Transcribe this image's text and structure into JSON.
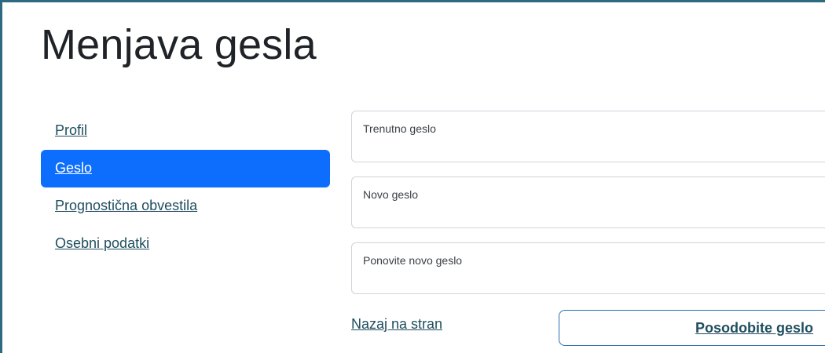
{
  "page": {
    "title": "Menjava gesla"
  },
  "sidebar": {
    "items": [
      {
        "label": "Profil",
        "active": false
      },
      {
        "label": "Geslo",
        "active": true
      },
      {
        "label": "Prognostična obvestila",
        "active": false
      },
      {
        "label": "Osebni podatki",
        "active": false
      }
    ]
  },
  "form": {
    "current_password": {
      "label": "Trenutno geslo",
      "value": ""
    },
    "new_password": {
      "label": "Novo geslo",
      "value": ""
    },
    "repeat_password": {
      "label": "Ponovite novo geslo",
      "value": ""
    },
    "back_link": "Nazaj na stran",
    "submit_label": "Posodobite geslo"
  },
  "colors": {
    "accent": "#0d6efd",
    "link": "#1f4e5f",
    "frame_border": "#2e6a7f"
  }
}
